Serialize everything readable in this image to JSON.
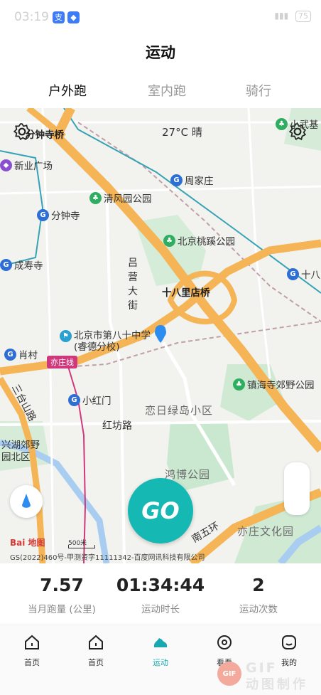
{
  "status_bar": {
    "time": "03:19",
    "battery": "75"
  },
  "header": {
    "title": "运动"
  },
  "tabs": [
    {
      "label": "户外跑",
      "active": true
    },
    {
      "label": "室内跑",
      "active": false
    },
    {
      "label": "骑行",
      "active": false
    }
  ],
  "map": {
    "weather": "27°C 晴",
    "pois": {
      "fenzhong_bridge": "分钟寺桥",
      "xinye": "新业广场",
      "fenzhongsi": "分钟寺",
      "chengshousi": "成寿寺",
      "qingfeng_park": "清风园公园",
      "zhoujiazhuang": "周家庄",
      "taoxi_park": "北京桃蹊公园",
      "shibali_bridge": "十八里店桥",
      "shiba": "十八",
      "wuji": "小武基",
      "school": "北京市第八十中学(睿德分校)",
      "xiaocun": "肖村",
      "xiaohongmen": "小红门",
      "zhenhaisi_park": "镇海寺郊野公园",
      "xinghu_park": "兴湖郊野园北区",
      "hongbo_park": "鸿博公园",
      "yizhuang_park": "亦庄文化园"
    },
    "areas": {
      "lianri": "恋日绿岛小区"
    },
    "roads": {
      "lvying": "吕营大街",
      "hongfang": "红坊路",
      "nanwuhuan": "南五环",
      "sihuan": "三台山路",
      "yizhuang_line": "亦庄线"
    },
    "go_label": "GO",
    "logo": "Bai 地图",
    "scale": "500米",
    "copyright": "GS(2022)460号-甲测资字11111342-百度网讯科技有限公司"
  },
  "stats": [
    {
      "value": "7.57",
      "label": "当月跑量 (公里)"
    },
    {
      "value": "01:34:44",
      "label": "运动时长"
    },
    {
      "value": "2",
      "label": "运动次数"
    }
  ],
  "bottom_nav": [
    {
      "label": "首页",
      "icon": "home-icon",
      "active": false
    },
    {
      "label": "首页",
      "icon": "home-icon",
      "active": false
    },
    {
      "label": "运动",
      "icon": "shoe-icon",
      "active": true
    },
    {
      "label": "看看",
      "icon": "eye-icon",
      "active": false
    },
    {
      "label": "我的",
      "icon": "face-icon",
      "active": false
    }
  ],
  "watermark": {
    "badge": "GIF",
    "line1": "GIF",
    "line2": "动图制作"
  },
  "colors": {
    "accent": "#15b8b2",
    "road_major": "#f5b455",
    "park_green": "#c9e8cf"
  }
}
